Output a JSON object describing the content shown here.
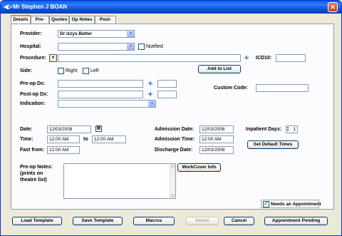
{
  "window": {
    "title": "Mr Stephen J BOAN",
    "close_glyph": "✕",
    "app_icon_glyph": "◀▷"
  },
  "tabs": [
    {
      "label": "Details"
    },
    {
      "label": "Pre-op"
    },
    {
      "label": "Quotes"
    },
    {
      "label": "Op Notes"
    },
    {
      "label": "Post-op"
    }
  ],
  "form": {
    "provider_label": "Provider:",
    "provider_value": "Dr Izzys Better",
    "hospital_label": "Hospital:",
    "hospital_value": "",
    "notified_label": "Notified",
    "procedure_label": "Procedure:",
    "procedure_value": "",
    "icd10_label": "ICD10:",
    "icd10_value": "",
    "side_label": "Side:",
    "right_label": "Right",
    "left_label": "Left",
    "add_to_list_label": "Add to List",
    "preop_dx_label": "Pre-op Dx:",
    "postop_dx_label": "Post-op Dx:",
    "custom_code_label": "Custom Code:",
    "indication_label": "Indication:",
    "date_label": "Date:",
    "date_value": "12/03/2008",
    "time_label": "Time:",
    "time_from": "12:00 AM",
    "to_label": "to",
    "time_to": "12:00 AM",
    "fast_from_label": "Fast from:",
    "fast_from_value": "12:00 AM",
    "admission_date_label": "Admission Date:",
    "admission_date_value": "12/03/2008",
    "admission_time_label": "Admission Time:",
    "admission_time_value": "12:00 AM",
    "discharge_date_label": "Discharge Date:",
    "discharge_date_value": "12/03/2008",
    "inpatient_days_label": "Inpatient Days:",
    "inpatient_days_value": "1",
    "set_default_times_label": "Set Default Times",
    "preop_notes_label": "Pre-op Notes:",
    "preop_notes_sub1": "(prints on",
    "preop_notes_sub2": "theatre list)",
    "workcover_info_label": "WorkCover Info",
    "needs_appointment_label": "Needs an Appointment"
  },
  "footer": {
    "load_template": "Load Template",
    "save_template": "Save Template",
    "macros": "Macros",
    "delete": "Delete",
    "cancel": "Cancel",
    "appointment_pending": "Appointment Pending"
  }
}
